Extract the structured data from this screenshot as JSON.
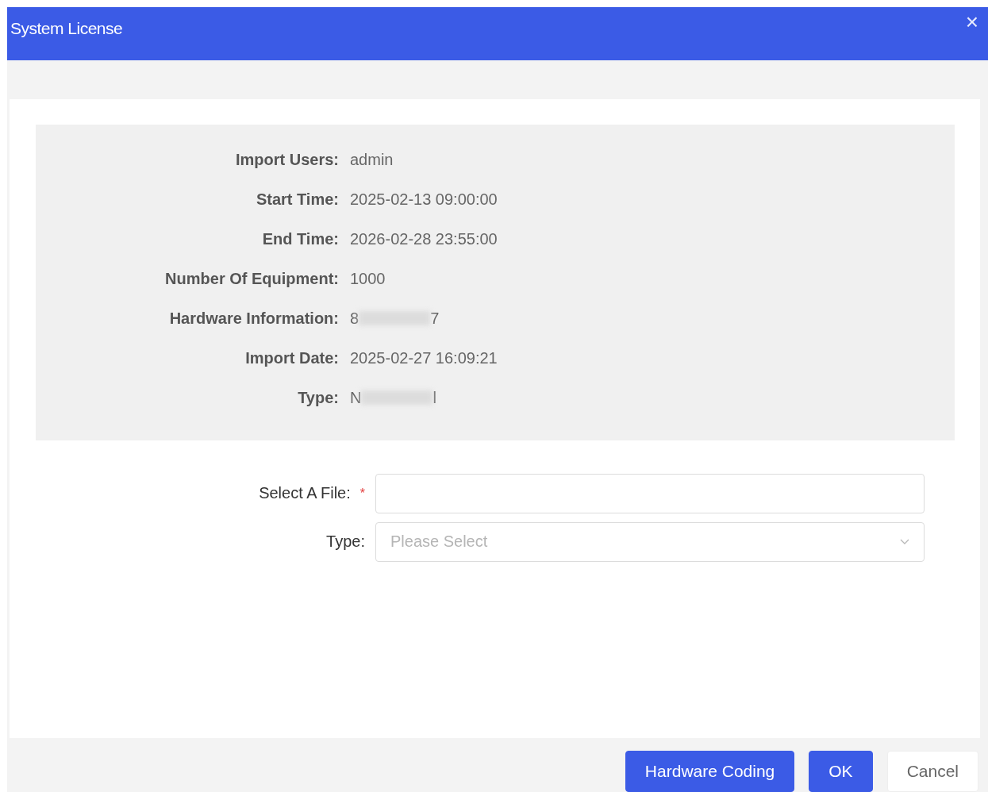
{
  "window": {
    "title": "System License",
    "close": "×"
  },
  "info": [
    {
      "label": "Import Users:",
      "value": "admin"
    },
    {
      "label": "Start Time:",
      "value": "2025-02-13 09:00:00"
    },
    {
      "label": "End Time:",
      "value": "2026-02-28 23:55:00"
    },
    {
      "label": "Number Of Equipment:",
      "value": "1000"
    },
    {
      "label": "Hardware Information:",
      "value": "8",
      "redacted": true,
      "value_end": "7"
    },
    {
      "label": "Import Date:",
      "value": "2025-02-27 16:09:21"
    },
    {
      "label": "Type:",
      "value": "N",
      "redacted": true,
      "value_end": "l"
    }
  ],
  "form": [
    {
      "kind": "file",
      "label": "Select A File:",
      "required": true,
      "required_mark": "*"
    },
    {
      "kind": "select",
      "label": "Type:",
      "required": false,
      "placeholder": "Please Select"
    }
  ],
  "buttons": [
    {
      "label": "Hardware Coding",
      "primary": true
    },
    {
      "label": "OK",
      "primary": true
    },
    {
      "label": "Cancel",
      "primary": false
    }
  ]
}
